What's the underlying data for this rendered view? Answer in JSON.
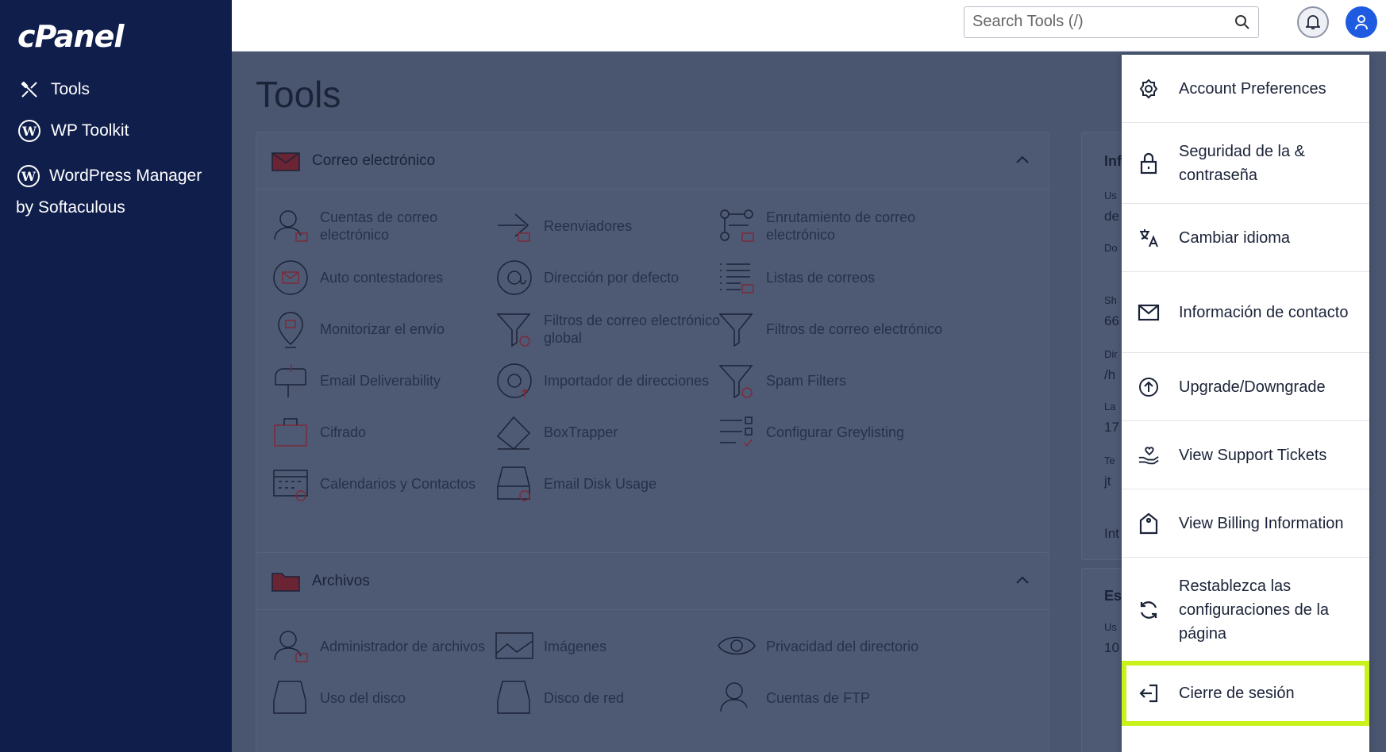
{
  "sidebar": {
    "logo": "cPanel",
    "items": [
      {
        "label": "Tools",
        "icon": "tools-icon"
      },
      {
        "label": "WP Toolkit",
        "icon": "wordpress-icon"
      },
      {
        "label": "WordPress Manager by Softaculous",
        "icon": "wordpress-icon"
      }
    ]
  },
  "topbar": {
    "search_placeholder": "Search Tools (/)"
  },
  "main": {
    "title": "Tools",
    "email_section": {
      "title": "Correo electrónico",
      "tools": [
        "Cuentas de correo electrónico",
        "Reenviadores",
        "Enrutamiento de correo electrónico",
        "Auto contestadores",
        "Dirección por defecto",
        "Listas de correos",
        "Monitorizar el envío",
        "Filtros de correo electrónico global",
        "Filtros de correo electrónico",
        "Email Deliverability",
        "Importador de direcciones",
        "Spam Filters",
        "Cifrado",
        "BoxTrapper",
        "Configurar Greylisting",
        "Calendarios y Contactos",
        "Email Disk Usage"
      ]
    },
    "files_section": {
      "title": "Archivos",
      "tools": [
        "Administrador de archivos",
        "Imágenes",
        "Privacidad del directorio",
        "Uso del disco",
        "Disco de red",
        "Cuentas de FTP"
      ]
    },
    "right_panel": {
      "heading": "Inf",
      "labels": [
        "Us",
        "de",
        "Do",
        "Sh",
        "66",
        "Dir",
        "/h",
        "La",
        "17",
        "Te",
        "jt",
        "Int"
      ],
      "heading2": "Est",
      "labels2": [
        "Us",
        "10"
      ]
    }
  },
  "dropdown": {
    "items": [
      {
        "label": "Account Preferences",
        "icon": "gear-icon"
      },
      {
        "label": "Seguridad de la & contraseña",
        "icon": "lock-icon"
      },
      {
        "label": "Cambiar idioma",
        "icon": "translate-icon"
      },
      {
        "label": "Información de contacto",
        "icon": "envelope-icon"
      },
      {
        "label": "Upgrade/Downgrade",
        "icon": "arrow-up-circle-icon"
      },
      {
        "label": "View Support Tickets",
        "icon": "support-hand-icon"
      },
      {
        "label": "View Billing Information",
        "icon": "billing-tag-icon"
      },
      {
        "label": "Restablezca las configuraciones de la página",
        "icon": "refresh-icon"
      },
      {
        "label": "Cierre de sesión",
        "icon": "logout-icon"
      }
    ]
  },
  "colors": {
    "sidebar_bg": "#0f1e4b",
    "overlay_bg": "#4a5670",
    "highlight": "#c8f21a",
    "user_avatar": "#1f5be0"
  }
}
